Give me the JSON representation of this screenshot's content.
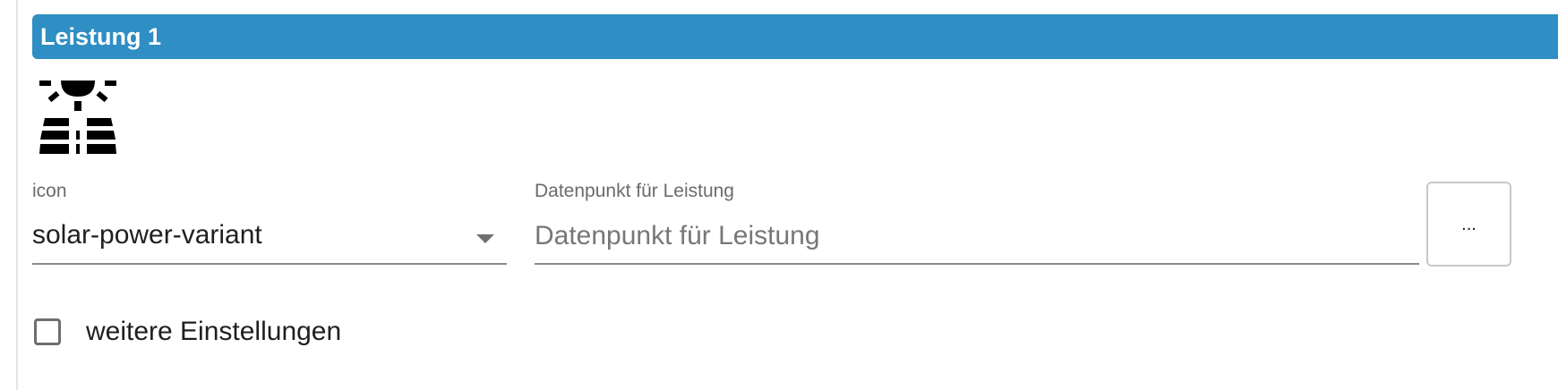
{
  "section": {
    "title": "Leistung 1",
    "header_color": "#2f8ec3"
  },
  "preview": {
    "icon_name": "solar-power-variant"
  },
  "icon_field": {
    "label": "icon",
    "value": "solar-power-variant"
  },
  "datapoint_field": {
    "label": "Datenpunkt für Leistung",
    "placeholder": "Datenpunkt für Leistung",
    "value": ""
  },
  "browse_button": {
    "label": "..."
  },
  "more_settings": {
    "label": "weitere Einstellungen",
    "checked": false
  }
}
